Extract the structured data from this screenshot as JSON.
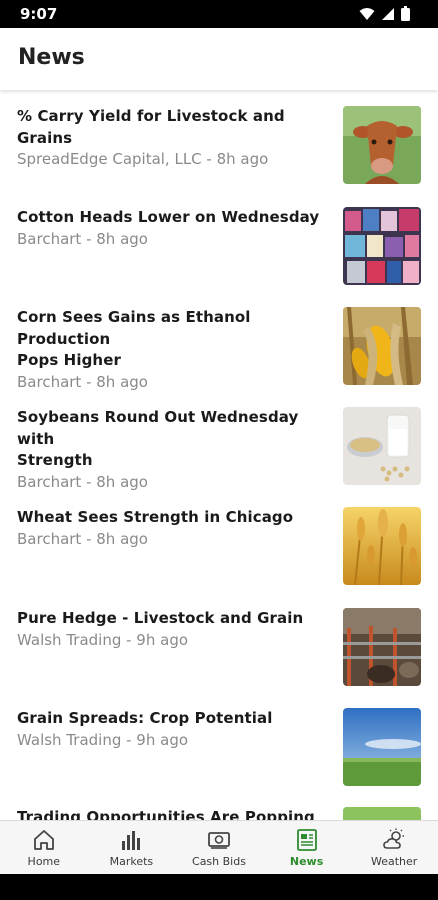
{
  "status_bar": {
    "time": "9:07",
    "icons": [
      "wifi-icon",
      "cellular-signal-icon",
      "battery-icon"
    ]
  },
  "header": {
    "title": "News"
  },
  "news": [
    {
      "title_lines": [
        "% Carry Yield for Livestock and Grains"
      ],
      "meta": "SpreadEdge Capital, LLC - 8h ago",
      "thumb": "cow-photo"
    },
    {
      "title_lines": [
        "Cotton Heads Lower on Wednesday"
      ],
      "meta": "Barchart - 8h ago",
      "thumb": "fabric-spools-photo"
    },
    {
      "title_lines": [
        "Corn Sees Gains as Ethanol Production",
        "Pops Higher"
      ],
      "meta": "Barchart - 8h ago",
      "thumb": "corn-photo"
    },
    {
      "title_lines": [
        "Soybeans Round Out Wednesday with",
        "Strength"
      ],
      "meta": "Barchart - 8h ago",
      "thumb": "soybeans-milk-photo"
    },
    {
      "title_lines": [
        "Wheat Sees Strength in Chicago"
      ],
      "meta": "Barchart - 8h ago",
      "thumb": "wheat-photo"
    },
    {
      "title_lines": [
        "Pure Hedge - Livestock and Grain"
      ],
      "meta": "Walsh Trading - 9h ago",
      "thumb": "livestock-barn-photo"
    },
    {
      "title_lines": [
        "Grain Spreads: Crop Potential"
      ],
      "meta": "Walsh Trading - 9h ago",
      "thumb": "field-sky-photo"
    },
    {
      "title_lines": [
        "Trading Opportunities Are Popping Up"
      ],
      "meta": "",
      "thumb": "green-field-photo"
    }
  ],
  "bottom_nav": [
    {
      "label": "Home",
      "icon": "home-icon",
      "active": false
    },
    {
      "label": "Markets",
      "icon": "bar-chart-icon",
      "active": false
    },
    {
      "label": "Cash Bids",
      "icon": "cash-icon",
      "active": false
    },
    {
      "label": "News",
      "icon": "newspaper-icon",
      "active": true
    },
    {
      "label": "Weather",
      "icon": "weather-icon",
      "active": false
    }
  ],
  "colors": {
    "accent": "#2e8b2e",
    "title_text": "#1a1a1a",
    "meta_text": "#8a8a8a"
  }
}
